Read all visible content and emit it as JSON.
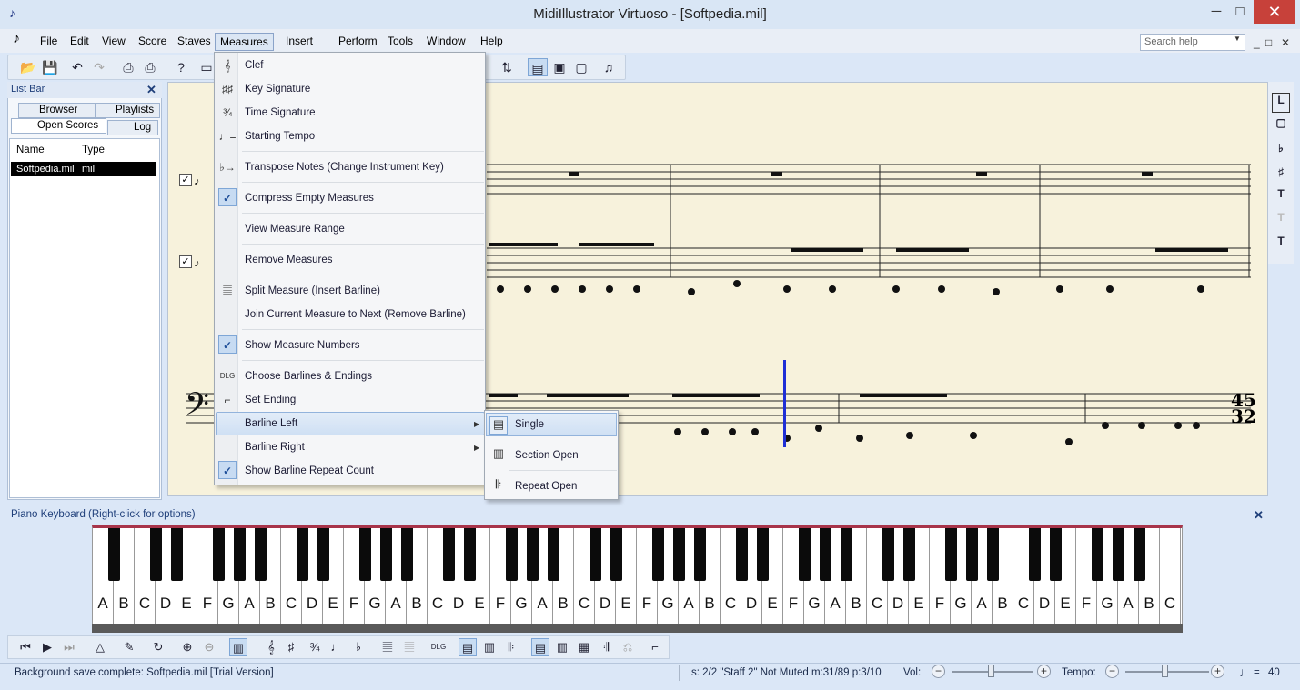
{
  "window": {
    "title": "MidiIllustrator Virtuoso - [Softpedia.mil]",
    "min": "─",
    "max": "□",
    "close": "✕"
  },
  "menubar": {
    "items": [
      "File",
      "Edit",
      "View",
      "Score",
      "Staves",
      "Measures",
      "Insert",
      "Perform",
      "Tools",
      "Window",
      "Help"
    ],
    "search_placeholder": "Search help",
    "mdi": [
      "_",
      "□",
      "✕"
    ]
  },
  "listbar": {
    "title": "List Bar",
    "tabs": [
      "Browser",
      "Playlists",
      "Open Scores",
      "Log"
    ],
    "columns": [
      "Name",
      "Type"
    ],
    "rows": [
      {
        "name": "Softpedia.mil",
        "type": "mil"
      }
    ]
  },
  "measures_menu": {
    "items": [
      {
        "label": "Clef",
        "icon": "clef-icon"
      },
      {
        "label": "Key Signature",
        "icon": "key-signature-icon"
      },
      {
        "label": "Time Signature",
        "icon": "time-signature-icon"
      },
      {
        "label": "Starting Tempo",
        "icon": "tempo-icon"
      },
      {
        "label": "Transpose Notes (Change Instrument Key)",
        "icon": "transpose-icon"
      },
      {
        "label": "Compress Empty Measures",
        "checked": true
      },
      {
        "label": "View Measure Range"
      },
      {
        "label": "Remove Measures"
      },
      {
        "label": "Split Measure (Insert Barline)",
        "icon": "split-measure-icon"
      },
      {
        "label": "Join Current Measure to Next (Remove Barline)"
      },
      {
        "label": "Show Measure Numbers",
        "checked": true
      },
      {
        "label": "Choose Barlines & Endings",
        "icon": "barlines-dlg-icon"
      },
      {
        "label": "Set Ending",
        "icon": "ending-icon"
      },
      {
        "label": "Barline Left",
        "submenu": true
      },
      {
        "label": "Barline Right",
        "submenu": true
      },
      {
        "label": "Show Barline Repeat Count",
        "checked": true
      }
    ]
  },
  "barline_submenu": {
    "items": [
      "Single",
      "Section Open",
      "Repeat Open"
    ]
  },
  "score": {
    "time_signature": {
      "top": "45",
      "bottom": "32"
    }
  },
  "piano": {
    "title": "Piano Keyboard (Right-click for options)",
    "white_keys": [
      "A",
      "B",
      "C",
      "D",
      "E",
      "F",
      "G",
      "A",
      "B",
      "C",
      "D",
      "E",
      "F",
      "G",
      "A",
      "B",
      "C",
      "D",
      "E",
      "F",
      "G",
      "A",
      "B",
      "C",
      "D",
      "E",
      "F",
      "G",
      "A",
      "B",
      "C",
      "D",
      "E",
      "F",
      "G",
      "A",
      "B",
      "C",
      "D",
      "E",
      "F",
      "G",
      "A",
      "B",
      "C",
      "D",
      "E",
      "F",
      "G",
      "A",
      "B",
      "C"
    ]
  },
  "status": {
    "message": "Background save complete: Softpedia.mil  [Trial Version]",
    "position": "s: 2/2 \"Staff 2\" Not Muted  m:31/89  p:3/10",
    "vol_label": "Vol:",
    "tempo_label": "Tempo:",
    "tempo_value": "40",
    "metronome_eq": "="
  }
}
